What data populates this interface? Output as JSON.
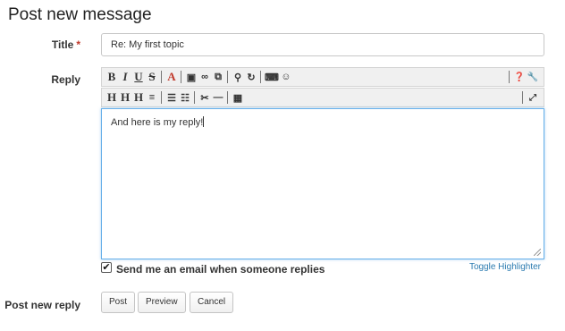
{
  "page": {
    "title": "Post new message"
  },
  "title_field": {
    "label": "Title",
    "required_mark": "*",
    "value": "Re: My first topic"
  },
  "reply_field": {
    "label": "Reply",
    "content": "And here is my reply!"
  },
  "toolbar": {
    "row1": [
      {
        "name": "bold-button",
        "glyph": "B",
        "type": "btn"
      },
      {
        "name": "italic-button",
        "glyph": "I",
        "type": "btn"
      },
      {
        "name": "underline-button",
        "glyph": "U",
        "type": "btn"
      },
      {
        "name": "strikethrough-button",
        "glyph": "S",
        "type": "btn"
      },
      {
        "type": "sep"
      },
      {
        "name": "font-color-button",
        "glyph": "A",
        "type": "btn"
      },
      {
        "type": "sep"
      },
      {
        "name": "image-icon",
        "glyph": "▣",
        "type": "btn"
      },
      {
        "name": "link-icon",
        "glyph": "∞",
        "type": "btn"
      },
      {
        "name": "external-link-icon",
        "glyph": "⧉",
        "type": "btn"
      },
      {
        "type": "sep"
      },
      {
        "name": "search-icon",
        "glyph": "⚲",
        "type": "btn"
      },
      {
        "name": "redo-icon",
        "glyph": "↻",
        "type": "btn"
      },
      {
        "type": "sep"
      },
      {
        "name": "keyboard-icon",
        "glyph": "⌨",
        "type": "btn"
      },
      {
        "name": "smiley-icon",
        "glyph": "☺",
        "type": "btn"
      }
    ],
    "row1_right": [
      {
        "name": "help-icon",
        "glyph": "❓"
      },
      {
        "name": "wrench-icon",
        "glyph": "🔧"
      }
    ],
    "row2": [
      {
        "name": "heading1-button",
        "glyph": "H",
        "type": "btn"
      },
      {
        "name": "heading2-button",
        "glyph": "H",
        "type": "btn"
      },
      {
        "name": "heading3-button",
        "glyph": "H",
        "type": "btn"
      },
      {
        "name": "align-center-icon",
        "glyph": "≡",
        "type": "btn"
      },
      {
        "type": "sep"
      },
      {
        "name": "bulleted-list-icon",
        "glyph": "☰",
        "type": "btn"
      },
      {
        "name": "numbered-list-icon",
        "glyph": "☷",
        "type": "btn"
      },
      {
        "type": "sep"
      },
      {
        "name": "cut-icon",
        "glyph": "✂",
        "type": "btn"
      },
      {
        "name": "horizontal-rule-icon",
        "glyph": "—",
        "type": "btn"
      },
      {
        "type": "sep"
      },
      {
        "name": "table-icon",
        "glyph": "▦",
        "type": "btn"
      }
    ],
    "row2_right": [
      {
        "name": "fullscreen-icon",
        "glyph": "⤢"
      }
    ]
  },
  "email_option": {
    "checked_glyph": "✔",
    "label": "Send me an email when someone replies"
  },
  "toggle_highlighter": "Toggle Highlighter",
  "submit": {
    "label": "Post new reply",
    "post": "Post",
    "preview": "Preview",
    "cancel": "Cancel"
  },
  "colors": {
    "focus_border": "#66afe9",
    "link": "#2a7ab0",
    "required": "#c0392b"
  }
}
